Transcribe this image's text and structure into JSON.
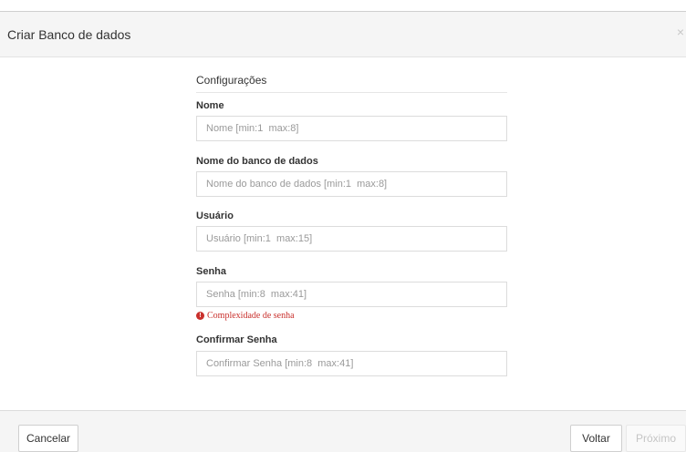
{
  "dialog": {
    "title": "Criar Banco de dados",
    "close_glyph": "×"
  },
  "form": {
    "section_title": "Configurações",
    "fields": [
      {
        "label": "Nome",
        "placeholder": "Nome [min:1  max:8]"
      },
      {
        "label": "Nome do banco de dados",
        "placeholder": "Nome do banco de dados [min:1  max:8]"
      },
      {
        "label": "Usuário",
        "placeholder": "Usuário [min:1  max:15]"
      },
      {
        "label": "Senha",
        "placeholder": "Senha [min:8  max:41]"
      },
      {
        "label": "Confirmar Senha",
        "placeholder": "Confirmar Senha [min:8  max:41]"
      }
    ],
    "password_error": "Complexidade de senha",
    "error_icon": "exclamation-circle-icon"
  },
  "footer": {
    "cancel_label": "Cancelar",
    "back_label": "Voltar",
    "next_label": "Próximo"
  },
  "colors": {
    "error": "#c9302c",
    "header_bg": "#f5f5f5"
  }
}
